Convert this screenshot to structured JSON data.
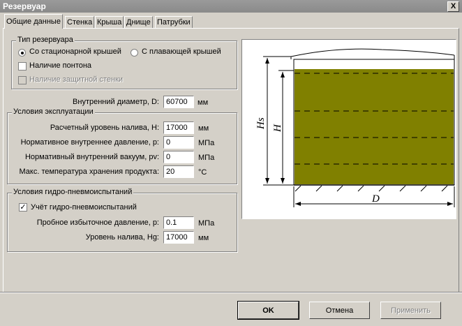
{
  "window": {
    "title": "Резервуар",
    "close_label": "X"
  },
  "tabs": [
    {
      "label": "Общие данные"
    },
    {
      "label": "Стенка"
    },
    {
      "label": "Крыша"
    },
    {
      "label": "Днище"
    },
    {
      "label": "Патрубки"
    }
  ],
  "tank_type": {
    "legend": "Тип резервуара",
    "option_fixed": "Со стационарной крышей",
    "option_floating": "С плавающей крышей",
    "pontoon_label": "Наличие понтона",
    "protective_wall_label": "Наличие защитной стенки"
  },
  "diameter": {
    "label": "Внутренний диаметр, D:",
    "value": "60700",
    "unit": "мм"
  },
  "operation": {
    "legend": "Условия эксплуатации",
    "fill_label": "Расчетный уровень налива, H:",
    "fill_value": "17000",
    "fill_unit": "мм",
    "pressure_label": "Нормативное внутреннее давление, p:",
    "pressure_value": "0",
    "pressure_unit": "МПа",
    "vacuum_label": "Нормативный внутренний вакуум, pv:",
    "vacuum_value": "0",
    "vacuum_unit": "МПа",
    "temp_label": "Макс. температура хранения продукта:",
    "temp_value": "20",
    "temp_unit": "°С"
  },
  "hydro_test": {
    "legend": "Условия гидро-пневмоиспытаний",
    "account_label": "Учёт гидро-пневмоиспытаний",
    "pressure_label": "Пробное избыточное давление, p:",
    "pressure_value": "0.1",
    "pressure_unit": "МПа",
    "level_label": "Уровень налива, Hg:",
    "level_value": "17000",
    "level_unit": "мм"
  },
  "diagram": {
    "label_hs": "Hs",
    "label_h": "H",
    "label_d": "D",
    "fill_color": "#808000"
  },
  "buttons": {
    "ok": "OK",
    "cancel": "Отмена",
    "apply": "Применить"
  }
}
